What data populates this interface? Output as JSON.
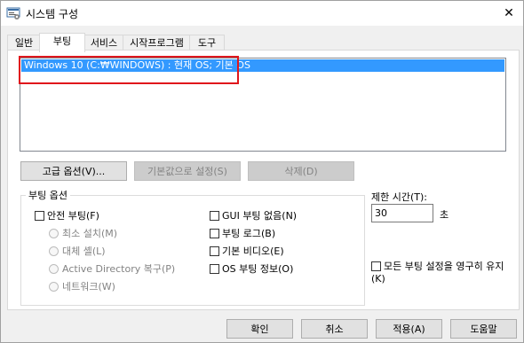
{
  "window": {
    "title": "시스템 구성",
    "app_icon": "msconfig-icon",
    "close_glyph": "✕"
  },
  "tabs": [
    {
      "label": "일반",
      "active": false
    },
    {
      "label": "부팅",
      "active": true
    },
    {
      "label": "서비스",
      "active": false
    },
    {
      "label": "시작프로그램",
      "active": false
    },
    {
      "label": "도구",
      "active": false
    }
  ],
  "boot_list": {
    "items": [
      {
        "label": "Windows 10 (C:₩WINDOWS) : 현재 OS; 기본 OS",
        "selected": true
      }
    ],
    "highlight_color": "#e0161c"
  },
  "buttons": {
    "advanced": "고급 옵션(V)...",
    "set_default": "기본값으로 설정(S)",
    "delete": "삭제(D)"
  },
  "boot_options": {
    "group_label": "부팅 옵션",
    "safe_boot": "안전 부팅(F)",
    "radios": [
      "최소 설치(M)",
      "대체 셸(L)",
      "Active Directory 복구(P)",
      "네트워크(W)"
    ],
    "right_checks": [
      "GUI 부팅 없음(N)",
      "부팅 로그(B)",
      "기본 비디오(E)",
      "OS 부팅 정보(O)"
    ]
  },
  "timeout": {
    "label": "제한 시간(T):",
    "value": "30",
    "unit": "초"
  },
  "permanent": {
    "label": "모든 부팅 설정을 영구히 유지(K)"
  },
  "footer": {
    "ok": "확인",
    "cancel": "취소",
    "apply": "적용(A)",
    "help": "도움말"
  },
  "colors": {
    "selection": "#3399ff",
    "highlight": "#e0161c"
  }
}
